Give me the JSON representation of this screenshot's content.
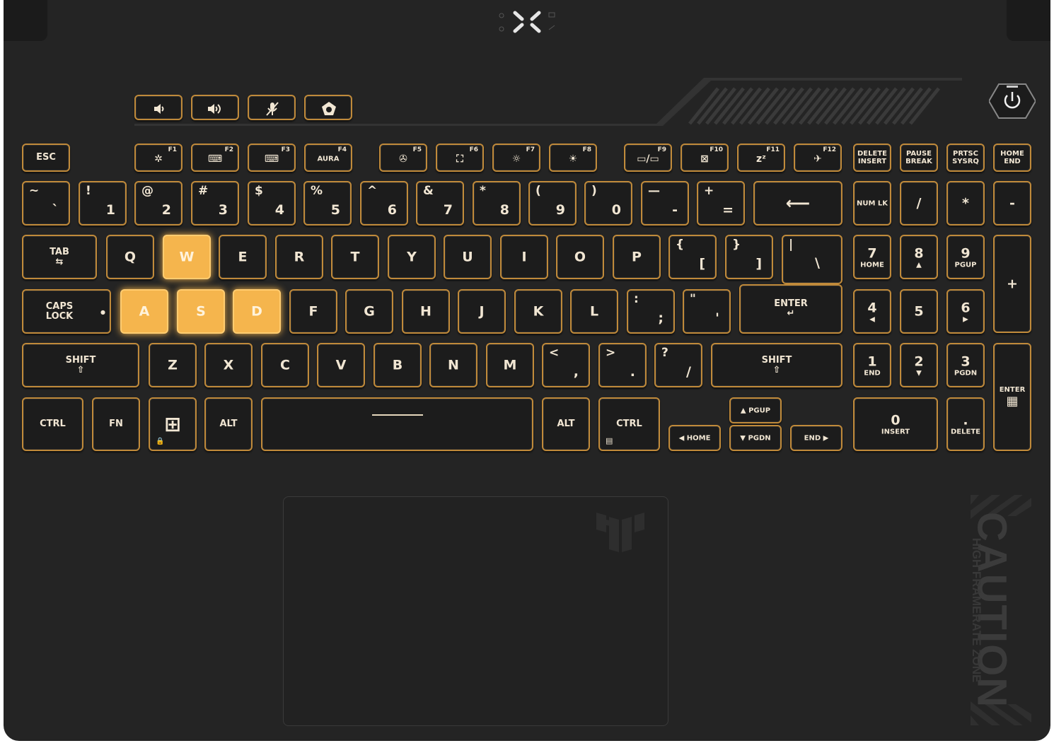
{
  "media_keys": [
    {
      "name": "volume-down",
      "icon": "🔉"
    },
    {
      "name": "volume-up",
      "icon": "🔊"
    },
    {
      "name": "mic-mute",
      "icon": "🎙"
    },
    {
      "name": "armoury-crate",
      "icon": "⬟"
    }
  ],
  "fn_row": {
    "esc": "ESC",
    "f1": "F1",
    "f2": "F2",
    "f3": "F3",
    "f4": "F4",
    "f4_label": "AURA",
    "f5": "F5",
    "f6": "F6",
    "f7": "F7",
    "f8": "F8",
    "f9": "F9",
    "f10": "F10",
    "f11": "F11",
    "f12": "F12",
    "delete": "DELETE",
    "insert": "INSERT",
    "pause": "PAUSE",
    "break": "BREAK",
    "prtsc": "PRTSC",
    "sysrq": "SYSRQ",
    "home": "HOME",
    "end": "END"
  },
  "num_row": {
    "tilde": "~",
    "backtick": "`",
    "k1_top": "!",
    "k1": "1",
    "k2_top": "@",
    "k2": "2",
    "k3_top": "#",
    "k3": "3",
    "k4_top": "$",
    "k4": "4",
    "k5_top": "%",
    "k5": "5",
    "k6_top": "^",
    "k6": "6",
    "k7_top": "&",
    "k7": "7",
    "k8_top": "*",
    "k8": "8",
    "k9_top": "(",
    "k9": "9",
    "k0_top": ")",
    "k0": "0",
    "minus_top": "—",
    "minus": "-",
    "plus_top": "+",
    "equals": "=",
    "backspace": "⟵",
    "numlk": "NUM LK",
    "slash": "/",
    "star": "*",
    "nminus": "-"
  },
  "row_q": {
    "tab": "TAB",
    "tab_icon": "⇆",
    "q": "Q",
    "w": "W",
    "e": "E",
    "r": "R",
    "t": "T",
    "y": "Y",
    "u": "U",
    "i": "I",
    "o": "O",
    "p": "P",
    "lbrace": "{",
    "lbracket": "[",
    "rbrace": "}",
    "rbracket": "]",
    "pipe": "|",
    "backslash": "\\",
    "n7": "7",
    "n7_sub": "HOME",
    "n8": "8",
    "n8_sub": "▲",
    "n9": "9",
    "n9_sub": "PGUP",
    "nplus": "+"
  },
  "row_a": {
    "caps1": "CAPS",
    "caps2": "LOCK",
    "a": "A",
    "s": "S",
    "d": "D",
    "f": "F",
    "g": "G",
    "h": "H",
    "j": "J",
    "k": "K",
    "l": "L",
    "colon": ":",
    "semicolon": ";",
    "quote": "\"",
    "apostrophe": "'",
    "enter": "ENTER",
    "enter_icon": "↵",
    "n4": "4",
    "n4_sub": "◀",
    "n5": "5",
    "n6": "6",
    "n6_sub": "▶"
  },
  "row_z": {
    "shift": "SHIFT",
    "shift_icon": "⇧",
    "z": "Z",
    "x": "X",
    "c": "C",
    "v": "V",
    "b": "B",
    "n": "N",
    "m": "M",
    "lt": "<",
    "comma": ",",
    "gt": ">",
    "period": ".",
    "question": "?",
    "slash": "/",
    "rshift": "SHIFT",
    "n1": "1",
    "n1_sub": "END",
    "n2": "2",
    "n2_sub": "▼",
    "n3": "3",
    "n3_sub": "PGDN",
    "nenter": "ENTER",
    "calc_icon": "▦"
  },
  "row_bottom": {
    "ctrl": "CTRL",
    "fn": "FN",
    "win_icon": "⊞",
    "alt": "ALT",
    "ralt": "ALT",
    "rctrl": "CTRL",
    "pgup": "▲ PGUP",
    "pgdn": "▼ PGDN",
    "home": "◀ HOME",
    "end": "END ▶",
    "n0": "0",
    "n0_sub": "INSERT",
    "ndot": ".",
    "ndot_sub": "DELETE"
  },
  "decal": {
    "caution": "CAUTION",
    "framerate": "HIGH FRAMERATE ZONE"
  },
  "colors": {
    "deck": "#242424",
    "keycap": "#1c1c1c",
    "backlight": "#c08a3a",
    "highlight": "#f5b54d"
  }
}
